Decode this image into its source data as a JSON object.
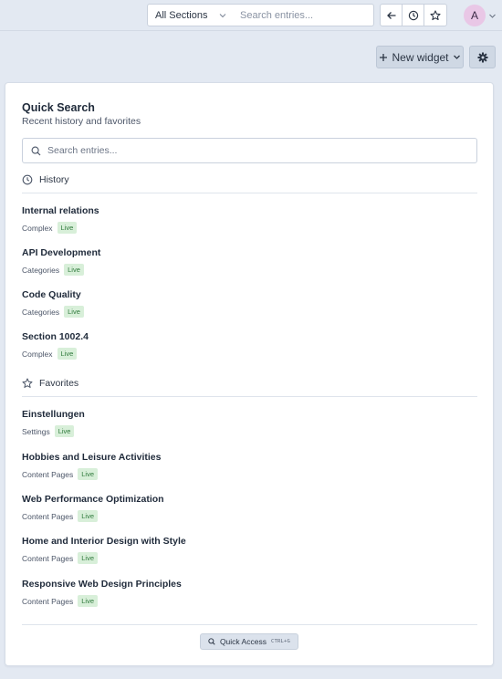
{
  "header": {
    "section_select": "All Sections",
    "search_placeholder": "Search entries...",
    "avatar_initial": "A",
    "icons": [
      "back-arrow-icon",
      "clock-icon",
      "star-icon",
      "chevron-down-icon"
    ]
  },
  "toolbar": {
    "new_widget_label": "New widget"
  },
  "widget": {
    "title": "Quick Search",
    "subtitle": "Recent history and favorites",
    "search_placeholder": "Search entries...",
    "history_label": "History",
    "favorites_label": "Favorites",
    "history": [
      {
        "title": "Internal relations",
        "type": "Complex",
        "status": "Live"
      },
      {
        "title": "API Development",
        "type": "Categories",
        "status": "Live"
      },
      {
        "title": "Code Quality",
        "type": "Categories",
        "status": "Live"
      },
      {
        "title": "Section 1002.4",
        "type": "Complex",
        "status": "Live"
      }
    ],
    "favorites": [
      {
        "title": "Einstellungen",
        "type": "Settings",
        "status": "Live"
      },
      {
        "title": "Hobbies and Leisure Activities",
        "type": "Content Pages",
        "status": "Live"
      },
      {
        "title": "Web Performance Optimization",
        "type": "Content Pages",
        "status": "Live"
      },
      {
        "title": "Home and Interior Design with Style",
        "type": "Content Pages",
        "status": "Live"
      },
      {
        "title": "Responsive Web Design Principles",
        "type": "Content Pages",
        "status": "Live"
      }
    ],
    "quick_access_label": "Quick Access",
    "quick_access_shortcut": "CTRL+G"
  },
  "colors": {
    "background": "#e3e9f2",
    "badge_bg": "#d8efd9",
    "badge_text": "#2f7a3c",
    "avatar_bg": "#e9c7e6"
  }
}
